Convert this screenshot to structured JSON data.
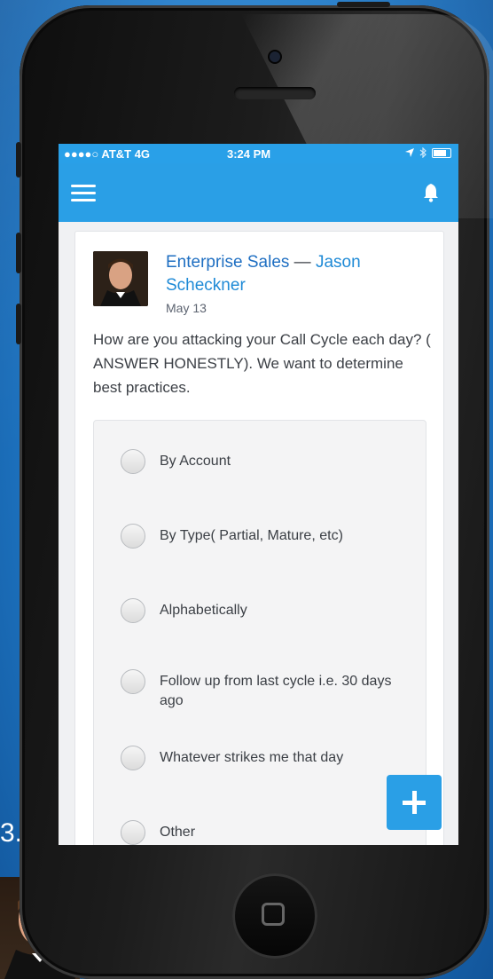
{
  "side_text": "3.",
  "statusbar": {
    "carrier": "●●●●○ AT&T  4G",
    "time": "3:24 PM"
  },
  "post": {
    "group": "Enterprise Sales",
    "separator": " — ",
    "author": "Jason Scheckner",
    "date": "May 13",
    "body": "How are you attacking your Call Cycle each day? ( ANSWER HONESTLY). We want to determine best practices."
  },
  "poll": {
    "options": [
      {
        "label": "By Account"
      },
      {
        "label": "By Type( Partial, Mature, etc)"
      },
      {
        "label": "Alphabetically"
      },
      {
        "label": "Follow up from last cycle i.e. 30 days ago"
      },
      {
        "label": "Whatever strikes me that day"
      },
      {
        "label": "Other"
      }
    ]
  },
  "colors": {
    "accent": "#2a9fe6",
    "link": "#1f8ad6",
    "background": "#1f78c6"
  },
  "icons": {
    "menu": "hamburger-menu-icon",
    "notifications": "bell-icon",
    "compose": "plus-icon",
    "location": "location-arrow-icon",
    "bluetooth": "bluetooth-icon",
    "battery": "battery-icon",
    "home": "home-button-icon"
  }
}
